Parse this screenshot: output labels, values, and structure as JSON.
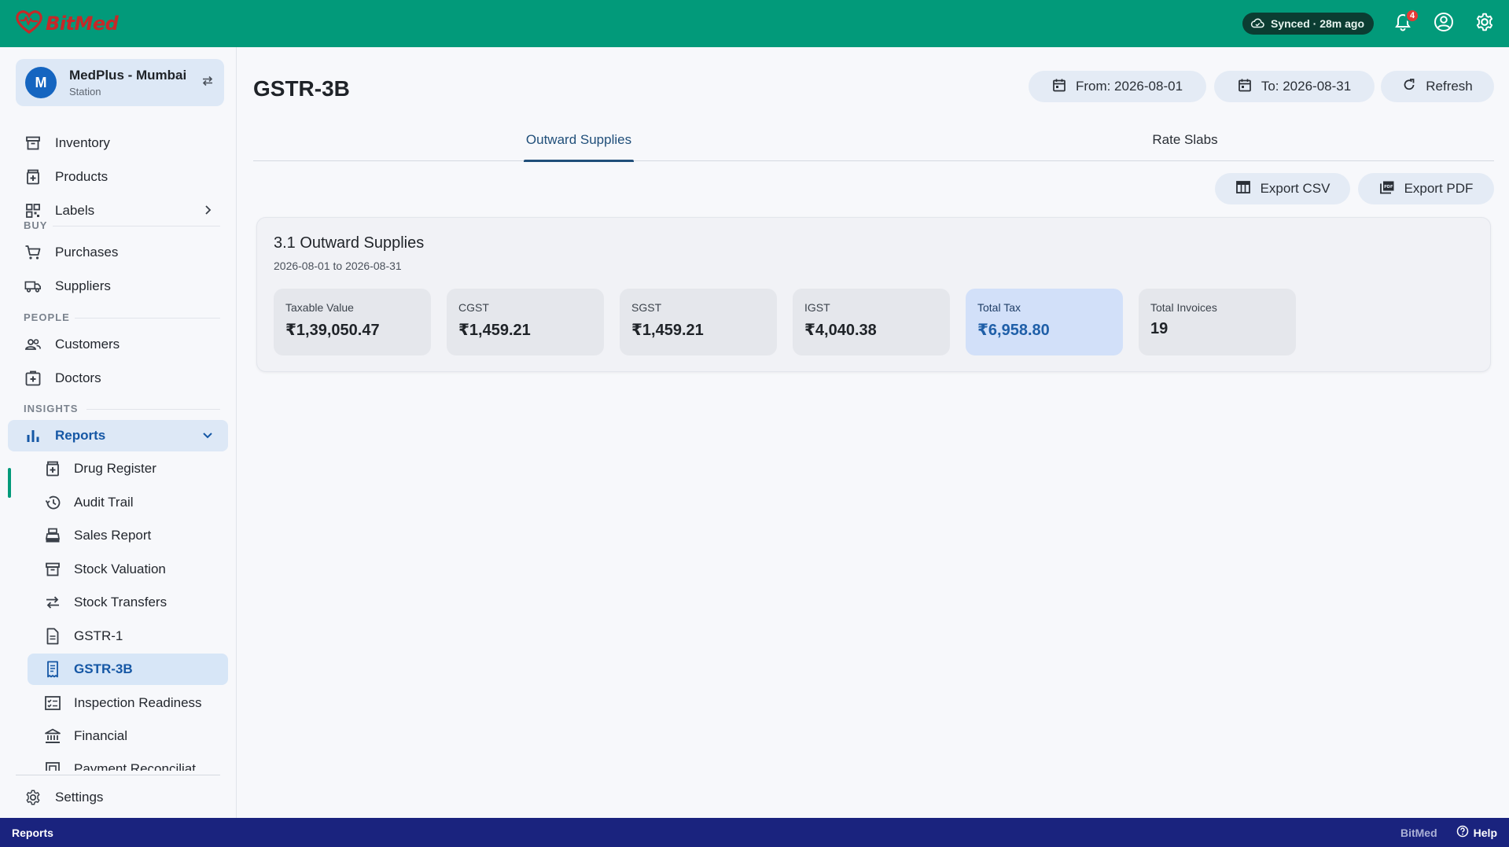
{
  "app": {
    "brand": "BitMed",
    "sync_status": "Synced · 28m ago",
    "notification_count": "4"
  },
  "station": {
    "avatar_letter": "M",
    "name": "MedPlus - Mumbai",
    "type": "Station"
  },
  "sidebar": {
    "items": [
      {
        "label": "Inventory",
        "icon": "archive-icon"
      },
      {
        "label": "Products",
        "icon": "medical-box-icon"
      },
      {
        "label": "Labels",
        "icon": "qr-code-icon"
      }
    ],
    "sections": {
      "buy": {
        "label": "BUY",
        "items": [
          {
            "label": "Purchases",
            "icon": "cart-icon"
          },
          {
            "label": "Suppliers",
            "icon": "truck-icon"
          }
        ]
      },
      "people": {
        "label": "PEOPLE",
        "items": [
          {
            "label": "Customers",
            "icon": "people-icon"
          },
          {
            "label": "Doctors",
            "icon": "medical-bag-icon"
          }
        ]
      },
      "insights": {
        "label": "INSIGHTS",
        "reports_label": "Reports",
        "reports_icon": "bar-chart-icon"
      }
    },
    "reports_sub": [
      {
        "label": "Drug Register",
        "icon": "medical-box-icon"
      },
      {
        "label": "Audit Trail",
        "icon": "history-icon"
      },
      {
        "label": "Sales Report",
        "icon": "cash-register-icon"
      },
      {
        "label": "Stock Valuation",
        "icon": "archive-icon"
      },
      {
        "label": "Stock Transfers",
        "icon": "transfer-icon"
      },
      {
        "label": "GSTR-1",
        "icon": "document-icon"
      },
      {
        "label": "GSTR-3B",
        "icon": "receipt-icon"
      },
      {
        "label": "Inspection Readiness",
        "icon": "checklist-icon"
      },
      {
        "label": "Financial",
        "icon": "bank-icon"
      },
      {
        "label": "Payment Reconciliat",
        "icon": "payment-icon"
      }
    ],
    "settings_label": "Settings"
  },
  "page": {
    "title": "GSTR-3B",
    "from_label": "From: 2026-08-01",
    "to_label": "To: 2026-08-31",
    "refresh_label": "Refresh",
    "tabs": [
      {
        "label": "Outward Supplies"
      },
      {
        "label": "Rate Slabs"
      }
    ],
    "export_csv_label": "Export CSV",
    "export_pdf_label": "Export PDF"
  },
  "summary": {
    "title": "3.1 Outward Supplies",
    "period": "2026-08-01 to 2026-08-31",
    "stats": [
      {
        "label": "Taxable Value",
        "value": "₹1,39,050.47"
      },
      {
        "label": "CGST",
        "value": "₹1,459.21"
      },
      {
        "label": "SGST",
        "value": "₹1,459.21"
      },
      {
        "label": "IGST",
        "value": "₹4,040.38"
      },
      {
        "label": "Total Tax",
        "value": "₹6,958.80"
      },
      {
        "label": "Total Invoices",
        "value": "19"
      }
    ]
  },
  "statusbar": {
    "current": "Reports",
    "brand": "BitMed",
    "help_label": "Help"
  },
  "colors": {
    "appbar": "#029a7a",
    "statusbar": "#1a237e",
    "accent_blue": "#1557a5",
    "highlight_card": "#d2e0f9",
    "badge": "#e53935"
  }
}
